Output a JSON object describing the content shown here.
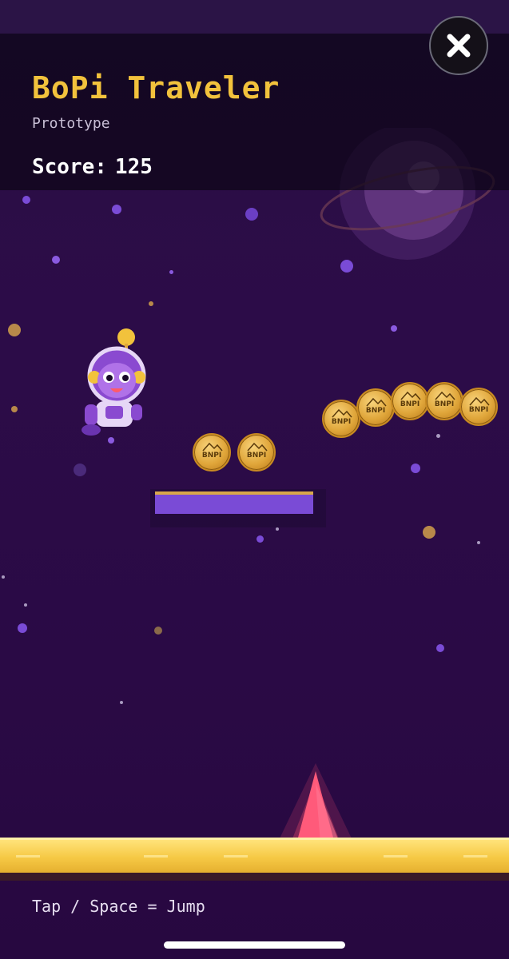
{
  "game": {
    "title": "BoPi Traveler",
    "subtitle": "Prototype",
    "score_label": "Score:",
    "score_value": "125",
    "controls_hint": "Tap / Space = Jump"
  },
  "coins": {
    "label": "BNPI",
    "count": 7
  },
  "colors": {
    "title": "#f2c23c",
    "background": "#2c0c48",
    "platform": "#7a4bd6",
    "ground": "#f6c945",
    "spike": "#ff4f72",
    "coin": "#e0a63a"
  },
  "icons": {
    "close": "close-icon",
    "player": "astronaut-character",
    "hazard": "spike-hazard",
    "planet": "ringed-planet"
  }
}
